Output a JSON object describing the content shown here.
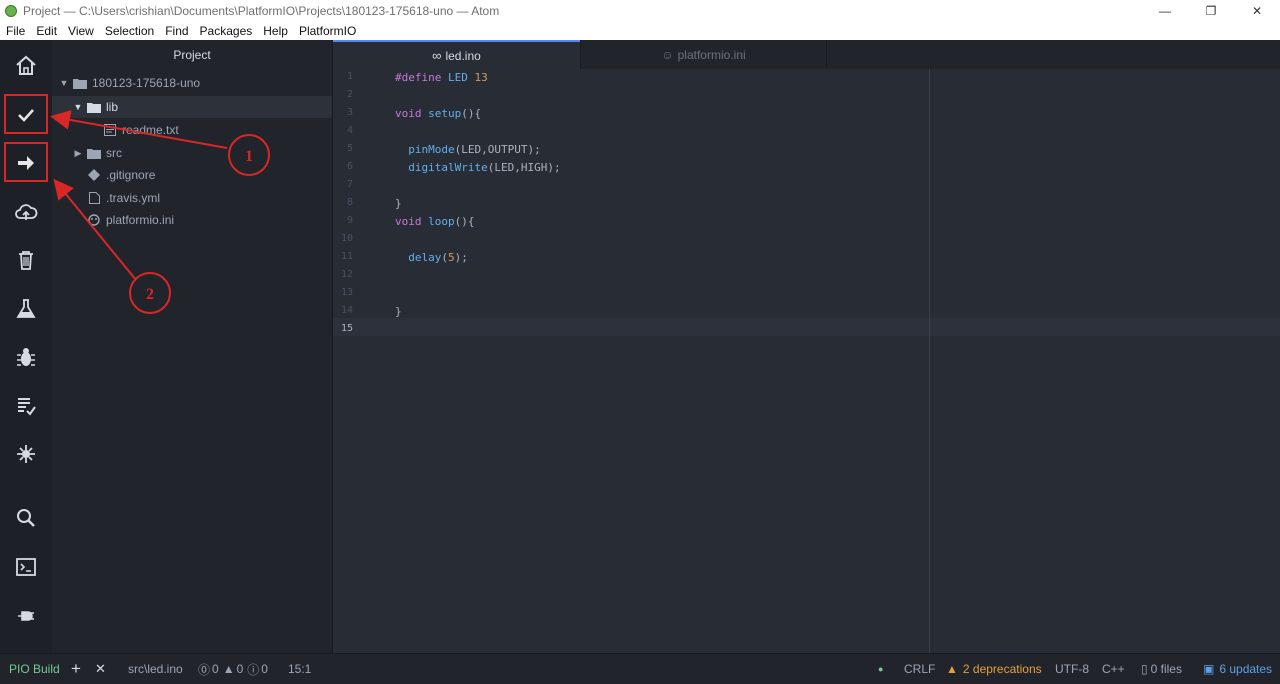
{
  "window": {
    "title": "Project — C:\\Users\\crishian\\Documents\\PlatformIO\\Projects\\180123-175618-uno — Atom",
    "minimize": "—",
    "restore": "❐",
    "close": "✕"
  },
  "menu": [
    "File",
    "Edit",
    "View",
    "Selection",
    "Find",
    "Packages",
    "Help",
    "PlatformIO"
  ],
  "toolbar": {
    "icons": [
      "home-icon",
      "build-check-icon",
      "upload-arrow-icon",
      "cloud-upload-icon",
      "trash-icon",
      "flask-icon",
      "bug-icon",
      "checklist-icon",
      "serial-monitor-icon",
      "search-icon",
      "terminal-icon",
      "plug-icon"
    ]
  },
  "tree": {
    "header": "Project",
    "root": "180123-175618-uno",
    "items": [
      {
        "label": "lib",
        "type": "folder",
        "expanded": true
      },
      {
        "label": "readme.txt",
        "type": "file"
      },
      {
        "label": "src",
        "type": "folder",
        "expanded": false
      },
      {
        "label": ".gitignore",
        "type": "file"
      },
      {
        "label": ".travis.yml",
        "type": "file"
      },
      {
        "label": "platformio.ini",
        "type": "file"
      }
    ]
  },
  "tabs": [
    {
      "label": "led.ino",
      "icon": "infinity-icon",
      "active": true
    },
    {
      "label": "platformio.ini",
      "icon": "alien-icon",
      "active": false
    }
  ],
  "editor": {
    "line_numbers": [
      "1",
      "2",
      "3",
      "4",
      "5",
      "6",
      "7",
      "8",
      "9",
      "10",
      "11",
      "12",
      "13",
      "14",
      "15"
    ],
    "current_line": 15,
    "lines": [
      [
        {
          "t": "#define ",
          "c": "kw"
        },
        {
          "t": "LED ",
          "c": "fn"
        },
        {
          "t": "13",
          "c": "num"
        }
      ],
      [],
      [
        {
          "t": "void ",
          "c": "kw"
        },
        {
          "t": "setup",
          "c": "fn"
        },
        {
          "t": "(){",
          "c": ""
        }
      ],
      [],
      [
        {
          "t": "  pinMode",
          "c": "fn"
        },
        {
          "t": "(LED,OUTPUT);",
          "c": ""
        }
      ],
      [
        {
          "t": "  digitalWrite",
          "c": "fn"
        },
        {
          "t": "(LED,HIGH);",
          "c": ""
        }
      ],
      [],
      [
        {
          "t": "}",
          "c": ""
        }
      ],
      [
        {
          "t": "void ",
          "c": "kw"
        },
        {
          "t": "loop",
          "c": "fn"
        },
        {
          "t": "(){",
          "c": ""
        }
      ],
      [],
      [
        {
          "t": "  delay",
          "c": "fn"
        },
        {
          "t": "(",
          "c": ""
        },
        {
          "t": "5",
          "c": "num"
        },
        {
          "t": ");",
          "c": ""
        }
      ],
      [],
      [],
      [
        {
          "t": "}",
          "c": ""
        }
      ],
      []
    ]
  },
  "annotations": {
    "one": "1",
    "two": "2"
  },
  "status": {
    "pio_build": "PIO Build",
    "add": "+",
    "close": "✕",
    "file_path": "src\\led.ino",
    "errors": "0",
    "warnings": "0",
    "infos": "0",
    "cursor": "15:1",
    "line_ending": "CRLF",
    "deprecations": "2 deprecations",
    "encoding": "UTF-8",
    "grammar": "C++",
    "files": "0 files",
    "updates": "6 updates"
  },
  "colors": {
    "accent": "#568af2",
    "annotation_red": "#d92626",
    "pio_green": "#73c991",
    "warning_orange": "#e5a03a",
    "updates_blue": "#5aa0e6"
  }
}
